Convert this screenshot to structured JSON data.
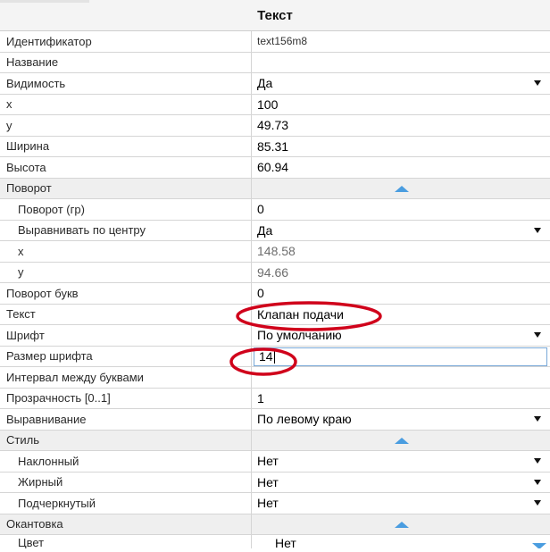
{
  "panel": {
    "title": "Текст"
  },
  "rows": [
    {
      "label": "Идентификатор",
      "value": "text156m8"
    },
    {
      "label": "Название",
      "value": ""
    },
    {
      "label": "Видимость",
      "value": "Да"
    },
    {
      "label": "x",
      "value": "100"
    },
    {
      "label": "y",
      "value": "49.73"
    },
    {
      "label": "Ширина",
      "value": "85.31"
    },
    {
      "label": "Высота",
      "value": "60.94"
    },
    {
      "label": "Поворот",
      "value": ""
    },
    {
      "label": "Поворот (гр)",
      "value": "0"
    },
    {
      "label": "Выравнивать по центру",
      "value": "Да"
    },
    {
      "label": "x",
      "value": "148.58"
    },
    {
      "label": "y",
      "value": "94.66"
    },
    {
      "label": "Поворот букв",
      "value": "0"
    },
    {
      "label": "Текст",
      "value": "Клапан подачи"
    },
    {
      "label": "Шрифт",
      "value": "По умолчанию"
    },
    {
      "label": "Размер шрифта",
      "value": "14"
    },
    {
      "label": "Интервал между буквами",
      "value": ""
    },
    {
      "label": "Прозрачность [0..1]",
      "value": "1"
    },
    {
      "label": "Выравнивание",
      "value": "По левому краю"
    },
    {
      "label": "Стиль",
      "value": ""
    },
    {
      "label": "Наклонный",
      "value": "Нет"
    },
    {
      "label": "Жирный",
      "value": "Нет"
    },
    {
      "label": "Подчеркнутый",
      "value": "Нет"
    },
    {
      "label": "Окантовка",
      "value": ""
    },
    {
      "label": "Цвет",
      "value": "Нет"
    }
  ],
  "colors": {
    "highlight": "#d0021b",
    "collapse": "#4a9de0",
    "active_border": "#78a8d8"
  },
  "icons": {
    "dropdown": "dropdown-arrow-icon",
    "collapse": "collapse-up-icon",
    "scroll": "scroll-down-icon"
  }
}
